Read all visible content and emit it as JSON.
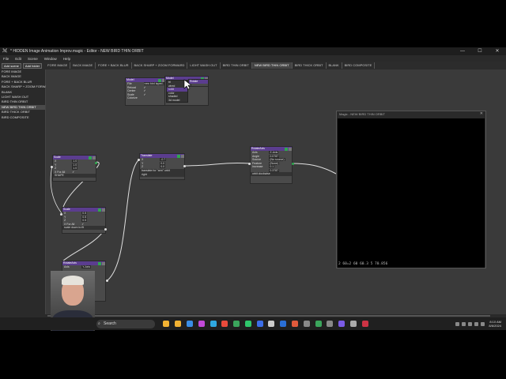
{
  "window": {
    "title": "* HIDDEN Image Animation Improv.magic - Editor - NEW BIRD THIN ORBIT",
    "minimize": "—",
    "maximize": "☐",
    "close": "✕"
  },
  "menu": [
    "File",
    "Edit",
    "Scene",
    "Window",
    "Help"
  ],
  "scene_tabs": {
    "add_scene": "Add scene",
    "add_folder": "Add folder",
    "tabs": [
      "FORE IMAGE",
      "BACK IMAGE",
      "FORE + BACK BLUR",
      "BACK SHARP + ZOOM FORWARD",
      "LIGHT WASH OUT",
      "BIRD THIN ORBIT",
      "NEW BIRD THIN ORBIT",
      "BIRD THICK ORBIT",
      "BLANK",
      "BIRD COMPOSITE"
    ],
    "active": "NEW BIRD THIN ORBIT"
  },
  "scene_list": {
    "items": [
      "FORE IMAGE",
      "BACK IMAGE",
      "FORE + BACK BLUR",
      "BACK SHARP + ZOOM FORW...",
      "BLANK",
      "LIGHT WASH OUT",
      "BIRD THIN ORBIT",
      "NEW BIRD THIN ORBIT",
      "BIRD THICK ORBIT",
      "BIRD COMPOSITE"
    ]
  },
  "nodes": {
    "model": {
      "title": "Model",
      "rows": [
        [
          "File",
          "new bird taped..."
        ],
        [
          "Reload",
          "✓"
        ],
        [
          "Center",
          "✓"
        ],
        [
          "Scale",
          "✓"
        ],
        [
          "Colorize",
          ""
        ]
      ]
    },
    "model_dropdown": {
      "title": "Model",
      "items": [
        "tri",
        "wired",
        "solid",
        "color",
        "shaded",
        "3d model"
      ],
      "highlighted": 2
    },
    "rotate_small": {
      "title": "Rotate"
    },
    "scale1": {
      "title": "Scale",
      "rows": [
        [
          "X",
          "1.0"
        ],
        [
          "Y",
          "1.0"
        ],
        [
          "Z",
          "1.0"
        ],
        [
          "X For All",
          "✓"
        ]
      ],
      "footer": "SHAPE"
    },
    "translate": {
      "title": "Translate",
      "rows": [
        [
          "X",
          "-0.7"
        ],
        [
          "Y",
          "0.0"
        ],
        [
          "Z",
          "0.0"
        ]
      ],
      "footer": "translate for \"arm\" orbit",
      "footer2": "right"
    },
    "rotate_axis": {
      "title": "RotateAxis",
      "rows": [
        [
          "Axis",
          "Z-Axis"
        ],
        [
          "Angle",
          "0.0787"
        ],
        [
          "Source",
          "(No source)"
        ],
        [
          "Feature",
          "(None)"
        ],
        [
          "Increase",
          "0.1"
        ],
        [
          "",
          "0.3787"
        ]
      ],
      "footer": "orbit clockwise"
    },
    "scale2": {
      "title": "Scale",
      "rows": [
        [
          "X",
          "0.5"
        ],
        [
          "Y",
          "0.5"
        ],
        [
          "Z",
          "0.5"
        ],
        [
          "X For All",
          "✓"
        ]
      ],
      "footer": "scale down to fit"
    },
    "rotate_axis2": {
      "title": "RotateAxis",
      "rows": [
        [
          "Axis",
          "Y-Axis"
        ]
      ]
    }
  },
  "preview": {
    "title": "Magic - NEW BIRD THIN ORBIT",
    "close": "✕",
    "stats": "2 60=2 60 60.3 5 70.856"
  },
  "taskbar": {
    "search_placeholder": "Search",
    "time": "8:10 AM",
    "date": "8/6/2024",
    "app_colors": [
      "#f2b233",
      "#f2b233",
      "#3a8ee6",
      "#c24ad9",
      "#2fa8e0",
      "#e94b3c",
      "#3ba55c",
      "#2fc66b",
      "#3c6ee8",
      "#cccccc",
      "#2a6fd6",
      "#e05a3c",
      "#888888",
      "#3ba55c",
      "#888888",
      "#7b5be6",
      "#aaaaaa",
      "#cc3344"
    ]
  },
  "colors": {
    "node_header": "#5b3d8f",
    "port_connected": "#2fa84f",
    "canvas": "#3a3a3a",
    "wire": "#e0e0e0"
  }
}
